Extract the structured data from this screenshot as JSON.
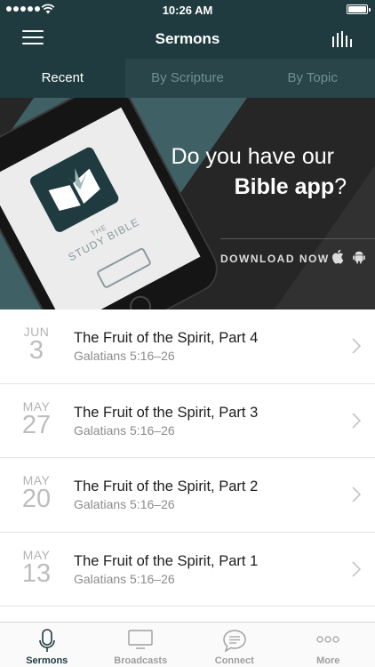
{
  "status_bar": {
    "time": "10:26 AM",
    "signal_dots": 5,
    "wifi_icon": "wifi-icon",
    "battery_icon": "battery-icon"
  },
  "header": {
    "title": "Sermons",
    "menu_icon": "hamburger-menu-icon",
    "action_icon": "bar-chart-icon"
  },
  "tabs": [
    {
      "label": "Recent",
      "active": true
    },
    {
      "label": "By Scripture",
      "active": false
    },
    {
      "label": "By Topic",
      "active": false
    }
  ],
  "banner": {
    "headline_line1": "Do you have our",
    "headline_bold": "Bible app",
    "headline_end": "?",
    "phone_label_top": "THE",
    "phone_label": "STUDY BIBLE",
    "cta": "DOWNLOAD NOW",
    "icons": [
      "apple-icon",
      "android-icon"
    ]
  },
  "sermons": [
    {
      "month": "JUN",
      "day": "3",
      "title": "The Fruit of the Spirit, Part 4",
      "scripture": "Galatians 5:16–26"
    },
    {
      "month": "MAY",
      "day": "27",
      "title": "The Fruit of the Spirit, Part 3",
      "scripture": "Galatians 5:16–26"
    },
    {
      "month": "MAY",
      "day": "20",
      "title": "The Fruit of the Spirit, Part 2",
      "scripture": "Galatians 5:16–26"
    },
    {
      "month": "MAY",
      "day": "13",
      "title": "The Fruit of the Spirit, Part 1",
      "scripture": "Galatians 5:16–26"
    }
  ],
  "bottom_nav": [
    {
      "label": "Sermons",
      "icon": "microphone-icon",
      "active": true
    },
    {
      "label": "Broadcasts",
      "icon": "television-icon",
      "active": false
    },
    {
      "label": "Connect",
      "icon": "chat-bubble-icon",
      "active": false
    },
    {
      "label": "More",
      "icon": "more-dots-icon",
      "active": false
    }
  ],
  "colors": {
    "primary": "#1f3b3f",
    "tab_inactive": "#2a4549",
    "banner_bg": "#262626",
    "accent_stripe": "#3f6064"
  }
}
